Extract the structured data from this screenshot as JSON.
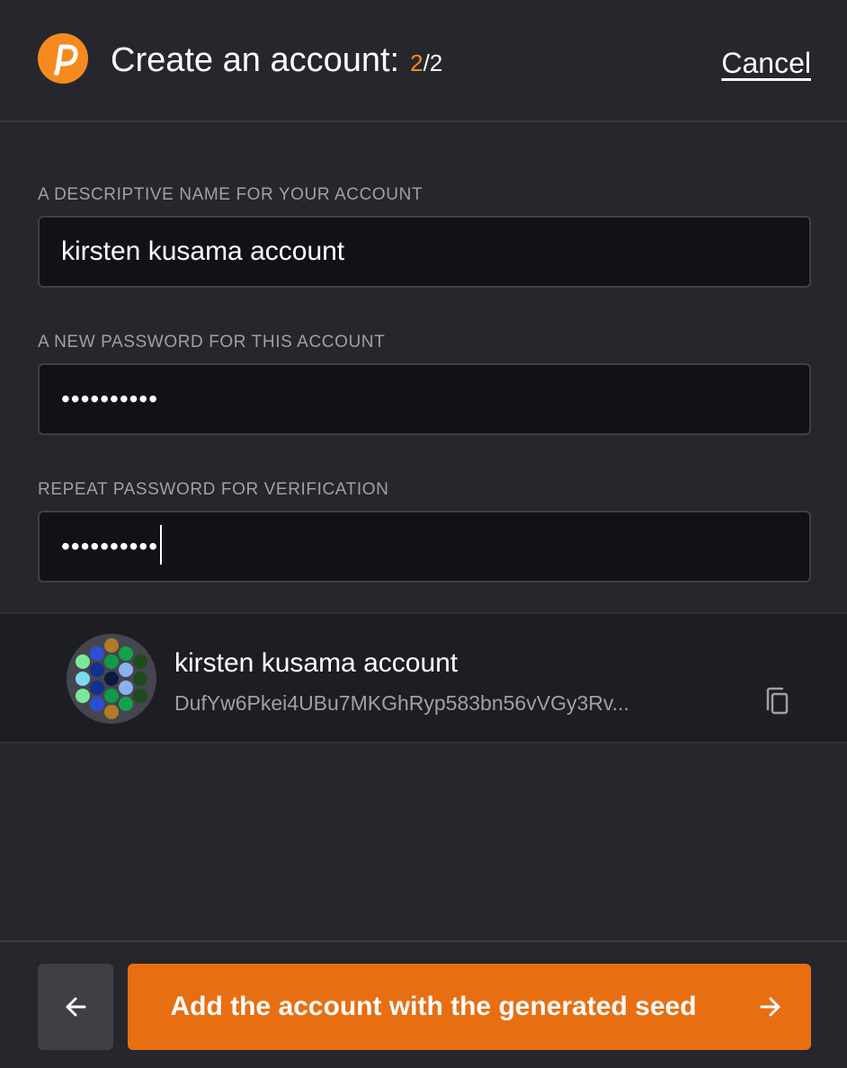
{
  "header": {
    "logo": "polkadot-logo",
    "title": "Create an account:",
    "step_current": "2",
    "step_total": "/2",
    "cancel_label": "Cancel"
  },
  "form": {
    "name_label": "A DESCRIPTIVE NAME FOR YOUR ACCOUNT",
    "name_value": "kirsten kusama account",
    "password_label": "A NEW PASSWORD FOR THIS ACCOUNT",
    "password_value": "••••••••••",
    "repeat_label": "REPEAT PASSWORD FOR VERIFICATION",
    "repeat_value": "••••••••••"
  },
  "account": {
    "name": "kirsten kusama account",
    "address": "DufYw6Pkei4UBu7MKGhRyp583bn56vVGy3Rv...",
    "identicon": "identicon",
    "copy_icon": "copy-icon"
  },
  "footer": {
    "back_icon": "arrow-left-icon",
    "primary_label": "Add the account with the generated seed",
    "primary_icon": "arrow-right-icon"
  },
  "colors": {
    "accent": "#e86e12",
    "logo": "#f68a1e",
    "background": "#26272c",
    "input_bg": "#111216"
  }
}
